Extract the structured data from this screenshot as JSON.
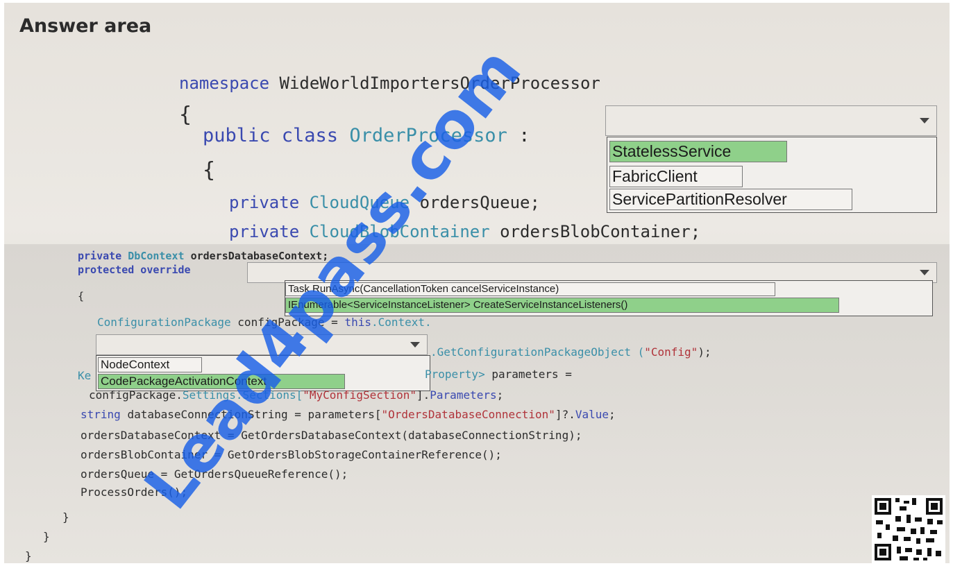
{
  "title": "Answer area",
  "code": {
    "namespace_kw": "namespace",
    "namespace_name": "WideWorldImportersOrderProcessor",
    "open_brace": "{",
    "public_kw": "public class",
    "class_name": "OrderProcessor",
    "colon": ":",
    "private_kw": "private",
    "cloudqueue_type": "CloudQueue",
    "cloudqueue_field": "ordersQueue;",
    "cloudblob_type": "CloudBlobContainer",
    "cloudblob_field": "ordersBlobContainer;",
    "dbcontext_line_kw": "private",
    "dbcontext_type": "DbContext",
    "dbcontext_field": "ordersDatabaseContext;",
    "protected_line": "protected override",
    "brace3": "{",
    "config_type": "ConfigurationPackage",
    "config_var": "configPackage =",
    "this_kw": "this",
    "context_word": ".Context.",
    "get_config": ".GetConfigurationPackageObject (",
    "config_str": "\"Config\"",
    "get_config_end": ");",
    "kv_start": "Ke",
    "kv_type": "Property>",
    "kv_rest": "parameters =",
    "settings_line_a": "configPackage.",
    "settings_line_b": "Settings.Sections[",
    "settings_str": "\"MyConfigSection\"",
    "settings_line_c": "].",
    "settings_params": "Parameters",
    "settings_end": ";",
    "string_kw": "string",
    "db_conn_a": "databaseConnectionString = parameters[",
    "db_conn_str": "\"OrdersDatabaseConnection\"",
    "db_conn_b": "]?.",
    "db_conn_value": "Value",
    "db_conn_end": ";",
    "line_dbctx": "ordersDatabaseContext = GetOrdersDatabaseContext(databaseConnectionString);",
    "line_blob": "ordersBlobContainer = GetOrdersBlobStorageContainerReference();",
    "line_queue": "ordersQueue = GetOrdersQueueReference();",
    "line_process": "ProcessOrders();",
    "close1": "}",
    "close2": "}",
    "close3": "}"
  },
  "dropdown1": {
    "options": [
      "StatelessService",
      "FabricClient",
      "ServicePartitionResolver"
    ],
    "selected": "StatelessService"
  },
  "dropdown2": {
    "options": [
      "Task RunAsync(CancellationToken cancelServiceInstance)",
      "IEnumerable<ServiceInstanceListener> CreateServiceInstanceListeners()"
    ],
    "selected": "IEnumerable<ServiceInstanceListener> CreateServiceInstanceListeners()"
  },
  "dropdown3": {
    "options": [
      "NodeContext",
      "CodePackageActivationContext"
    ],
    "selected": "CodePackageActivationContext"
  },
  "watermark": "Lead4pass.com",
  "colors": {
    "keyword": "#3a49b0",
    "type": "#3a8fa8",
    "string": "#b0333a",
    "selected_option": "#8fd08a",
    "watermark": "#195fe6"
  }
}
